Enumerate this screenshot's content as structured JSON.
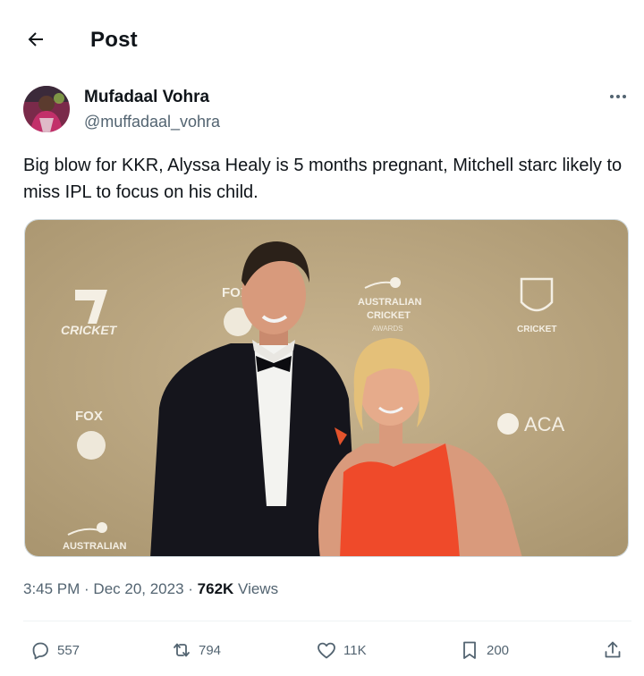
{
  "header": {
    "title": "Post"
  },
  "author": {
    "display_name": "Mufadaal Vohra",
    "handle": "@muffadaal_vohra"
  },
  "tweet": {
    "text": "Big blow for KKR, Alyssa Healy is 5 months pregnant, Mitchell starc likely to miss IPL to focus on his child."
  },
  "media": {
    "backdrop_logos": {
      "cricket_7": "CRICKET",
      "fox": "FOX",
      "australian": "AUSTRALIAN",
      "cricket": "CRICKET",
      "awards": "AWARDS",
      "cricket_australia": "CRICKET",
      "aca": "ACA"
    }
  },
  "meta": {
    "time": "3:45 PM",
    "separator": " · ",
    "date": "Dec 20, 2023",
    "views_count": "762K",
    "views_label": " Views"
  },
  "actions": {
    "replies": "557",
    "reposts": "794",
    "likes": "11K",
    "bookmarks": "200"
  },
  "colors": {
    "text_primary": "#0f1419",
    "text_secondary": "#536471",
    "divider": "#eff3f4"
  }
}
